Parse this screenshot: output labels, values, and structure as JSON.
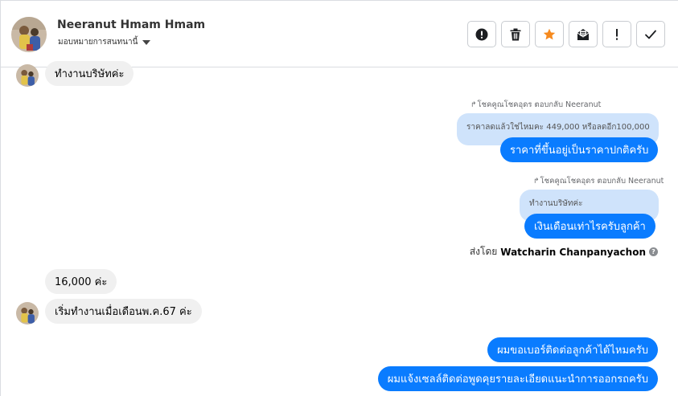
{
  "header": {
    "contact_name": "Neeranut Hmam Hmam",
    "assign_label": "มอบหมายการสนทนานี้",
    "actions": [
      {
        "icon": "alert-circle-icon",
        "glyph": "!"
      },
      {
        "icon": "trash-icon"
      },
      {
        "icon": "star-icon",
        "color": "#f68a1e"
      },
      {
        "icon": "mark-unread-icon"
      },
      {
        "icon": "exclamation-icon",
        "glyph": "!"
      },
      {
        "icon": "check-icon"
      }
    ]
  },
  "messages": {
    "m1": "ทำงานบริษัทค่ะ",
    "reply1_header": "โชคคูณโชคอุดร ตอบกลับ Neeranut",
    "reply1_quote": "ราคาลดแล้วใช่ไหมคะ 449,000 หรือลดอีก100,000",
    "reply1_text": "ราคาที่ขึ้นอยู่เป็นราคาปกติครับ",
    "reply2_header": "โชคคูณโชคอุดร ตอบกลับ Neeranut",
    "reply2_quote": "ทำงานบริษัทค่ะ",
    "reply2_text": "เงินเดือนเท่าไรครับลูกค้า",
    "sent_by_prefix": "ส่งโดย",
    "sent_by_name": "Watcharin Chanpanyachon",
    "m2": "16,000 ค่ะ",
    "m3": "เริ่มทำงานเมื่อเดือนพ.ค.67 ค่ะ",
    "out1": "ผมขอเบอร์ติดต่อลูกค้าได้ไหมครับ",
    "out2": "ผมแจ้งเซลล์ติดต่อพูดคุยรายละเอียดแนะนำการออกรถครับ"
  },
  "colors": {
    "outgoing_bubble": "#0a7cff",
    "incoming_bubble": "#f0f0f0",
    "quote_bubble": "#cfe3fb",
    "star": "#f68a1e"
  }
}
